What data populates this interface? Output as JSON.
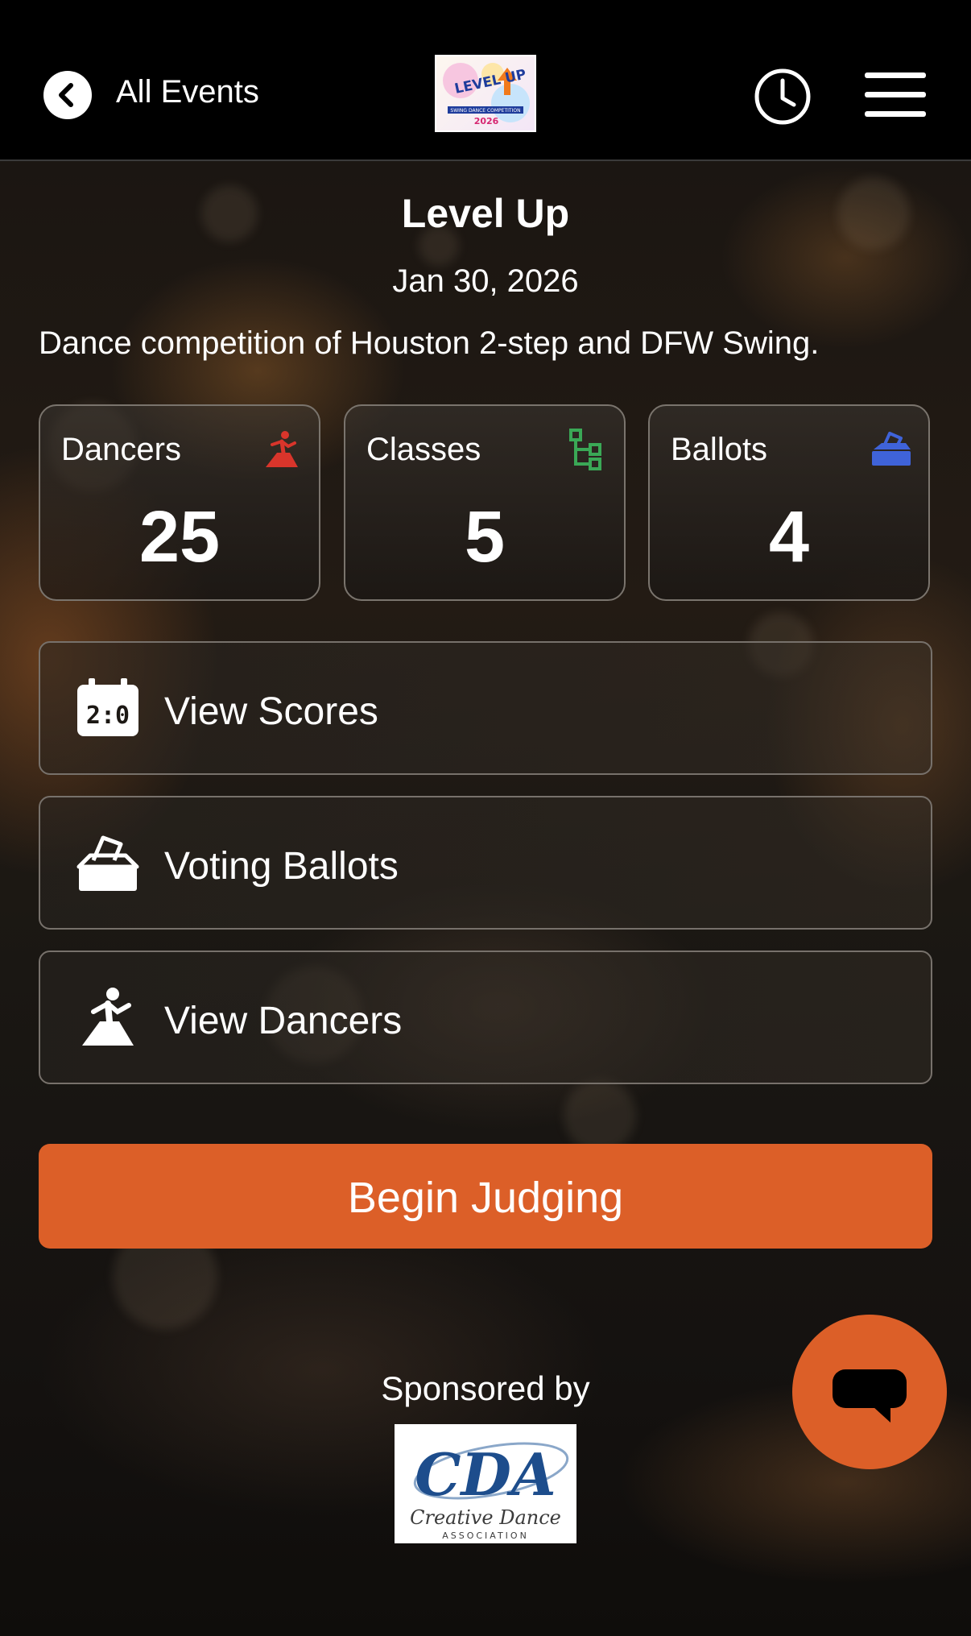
{
  "topbar": {
    "back_label": "All Events",
    "logo_text": "LEVEL UP",
    "logo_subtitle": "SWING DANCE COMPETITION",
    "logo_year": "2026"
  },
  "event": {
    "title": "Level Up",
    "date": "Jan 30, 2026",
    "description": "Dance competition of Houston 2-step and DFW Swing."
  },
  "stats": [
    {
      "label": "Dancers",
      "value": "25",
      "icon": "dancer-icon",
      "color": "#d9352b"
    },
    {
      "label": "Classes",
      "value": "5",
      "icon": "hierarchy-icon",
      "color": "#3aa856"
    },
    {
      "label": "Ballots",
      "value": "4",
      "icon": "ballot-box-icon",
      "color": "#3f63d9"
    }
  ],
  "actions": [
    {
      "label": "View Scores",
      "icon": "scoreboard-icon"
    },
    {
      "label": "Voting Ballots",
      "icon": "ballot-box-icon"
    },
    {
      "label": "View Dancers",
      "icon": "dancer-icon"
    }
  ],
  "begin_label": "Begin Judging",
  "footer": {
    "sponsored_label": "Sponsored by",
    "sponsor_logo_text": "CDA",
    "sponsor_name": "Creative Dance",
    "sponsor_sub": "ASSOCIATION"
  },
  "colors": {
    "accent": "#dc5f28",
    "topbar": "#000000"
  }
}
